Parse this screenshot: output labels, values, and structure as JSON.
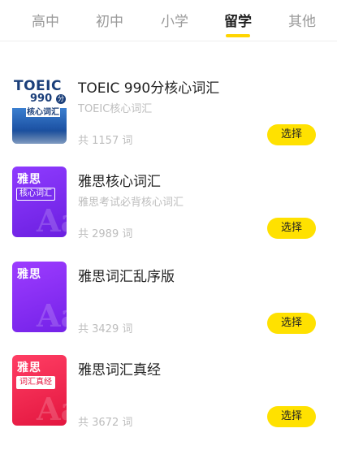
{
  "tabs": [
    {
      "label": "高中"
    },
    {
      "label": "初中"
    },
    {
      "label": "小学"
    },
    {
      "label": "留学"
    },
    {
      "label": "其他"
    }
  ],
  "active_tab": "留学",
  "books": [
    {
      "title": "TOEIC 990分核心词汇",
      "subtitle": "TOEIC核心词汇",
      "count": "共 1157 词",
      "button": "选择",
      "cover_brand": "TOEIC",
      "cover_score": "990",
      "cover_score_unit": "分",
      "cover_tag": "核心词汇"
    },
    {
      "title": "雅思核心词汇",
      "subtitle": "雅思考试必背核心词汇",
      "count": "共 2989 词",
      "button": "选择",
      "cover_title": "雅思",
      "cover_tag": "核心词汇",
      "cover_mark": "Aa"
    },
    {
      "title": "雅思词汇乱序版",
      "subtitle": "",
      "count": "共 3429 词",
      "button": "选择",
      "cover_title": "雅思",
      "cover_mark": "Aa"
    },
    {
      "title": "雅思词汇真经",
      "subtitle": "",
      "count": "共 3672 词",
      "button": "选择",
      "cover_title": "雅思",
      "cover_tag": "词汇真经",
      "cover_mark": "Aa"
    }
  ],
  "colors": {
    "accent": "#ffe100",
    "cover_purple": "#8f3bff",
    "cover_red": "#ff3e64"
  }
}
